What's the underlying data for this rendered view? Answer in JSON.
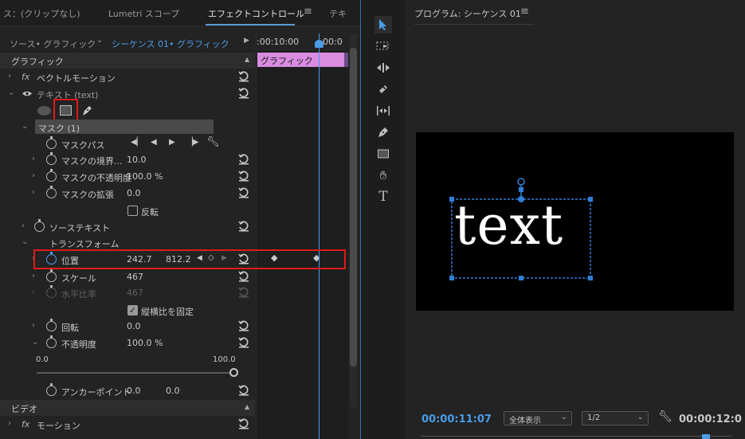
{
  "effect_controls": {
    "tabs": [
      {
        "label": "ス：(クリップなし)"
      },
      {
        "label": "Lumetri スコープ"
      },
      {
        "label": "エフェクトコントロール"
      },
      {
        "label": "テキ"
      }
    ],
    "tab_menu_icon": "hamburger-icon",
    "source_label": "ソース• グラフィック",
    "sequence_label": "シーケンス 01• グラフィック",
    "ruler_time": ":00:10:00",
    "ruler_time2": "00:0",
    "clip_label": "グラフィック",
    "sections": {
      "graphic": "グラフィック",
      "video": "ビデオ"
    },
    "rows": {
      "vector_motion": {
        "fx": "fx",
        "label": "ベクトルモーション"
      },
      "text_layer": {
        "label": "テキスト (text)"
      },
      "mask": {
        "label": "マスク (1)"
      },
      "mask_path": {
        "label": "マスクパス"
      },
      "mask_feather": {
        "label": "マスクの境界...",
        "value": "10.0"
      },
      "mask_opacity": {
        "label": "マスクの不透明度",
        "value": "100.0 %"
      },
      "mask_expansion": {
        "label": "マスクの拡張",
        "value": "0.0"
      },
      "invert": {
        "label": "反転"
      },
      "source_text": {
        "label": "ソーステキスト"
      },
      "transform": {
        "label": "トランスフォーム"
      },
      "position": {
        "label": "位置",
        "x": "242.7",
        "y": "812.2"
      },
      "scale": {
        "label": "スケール",
        "value": "467"
      },
      "scale_width": {
        "label": "水平比率",
        "value": "467"
      },
      "uniform_scale": {
        "label": "縦横比を固定"
      },
      "rotation": {
        "label": "回転",
        "value": "0.0"
      },
      "opacity": {
        "label": "不透明度",
        "value": "100.0 %"
      },
      "slider_min": "0.0",
      "slider_max": "100.0",
      "anchor": {
        "label": "アンカーポイント",
        "x": "0.0",
        "y": "0.0"
      },
      "motion": {
        "fx": "fx",
        "label": "モーション"
      }
    }
  },
  "program_monitor": {
    "title": "プログラム: シーケンス 01",
    "menu_icon": "hamburger-icon",
    "frame_text": "text",
    "current_time": "00:00:11:07",
    "fit_select": "全体表示",
    "resolution_select": "1/2",
    "duration": "00:00:12:0"
  },
  "colors": {
    "accent": "#4a9ce8",
    "clip": "#d98ce0",
    "highlight": "#e01a1a",
    "panel": "#232323"
  }
}
